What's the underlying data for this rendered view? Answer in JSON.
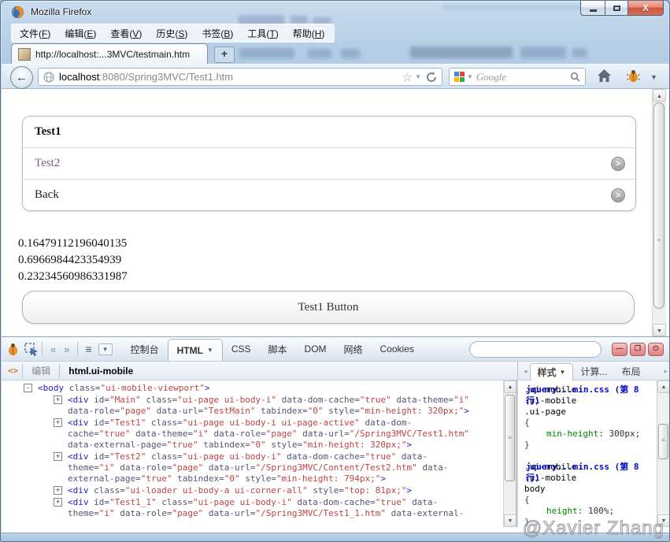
{
  "window": {
    "title": "Mozilla Firefox"
  },
  "titlebar": {
    "buttons": [
      "minimize",
      "maximize",
      "close"
    ],
    "close_glyph": "X"
  },
  "menu": {
    "items": [
      {
        "pre": "文件(",
        "key": "F",
        "post": ")"
      },
      {
        "pre": "编辑(",
        "key": "E",
        "post": ")"
      },
      {
        "pre": "查看(",
        "key": "V",
        "post": ")"
      },
      {
        "pre": "历史(",
        "key": "S",
        "post": ")"
      },
      {
        "pre": "书签(",
        "key": "B",
        "post": ")"
      },
      {
        "pre": "工具(",
        "key": "T",
        "post": ")"
      },
      {
        "pre": "帮助(",
        "key": "H",
        "post": ")"
      }
    ]
  },
  "tabbar": {
    "tab_title": "http://localhost:...3MVC/testmain.htm",
    "new_tab_label": "+"
  },
  "navbar": {
    "back_glyph": "←",
    "url_host": "localhost",
    "url_path": ":8080/Spring3MVC/Test1.htm",
    "star_glyph": "☆",
    "search_placeholder": "Google"
  },
  "page": {
    "list_items": [
      {
        "label": "Test1",
        "style": "header",
        "chevron": false
      },
      {
        "label": "Test2",
        "style": "visited",
        "chevron": true
      },
      {
        "label": "Back",
        "style": "normal",
        "chevron": true
      }
    ],
    "chevron_glyph": ">",
    "random_numbers": [
      "0.16479112196040135",
      "0.6966984423354939",
      "0.23234560986331987"
    ],
    "button_label": "Test1 Button"
  },
  "firebug": {
    "tabs": [
      {
        "label": "控制台",
        "active": false,
        "caret": false
      },
      {
        "label": "HTML",
        "active": true,
        "caret": true
      },
      {
        "label": "CSS",
        "active": false,
        "caret": false
      },
      {
        "label": "脚本",
        "active": false,
        "caret": false
      },
      {
        "label": "DOM",
        "active": false,
        "caret": false
      },
      {
        "label": "网络",
        "active": false,
        "caret": false
      },
      {
        "label": "Cookies",
        "active": false,
        "caret": false
      }
    ],
    "edit_label": "编辑",
    "breadcrumb": "html.ui-mobile",
    "style_tabs": [
      {
        "label": "样式",
        "active": true,
        "caret": true
      },
      {
        "label": "计算...",
        "active": false,
        "caret": false
      },
      {
        "label": "布局",
        "active": false,
        "caret": false
      }
    ],
    "tree": [
      {
        "exp": "-",
        "indent": 0,
        "parts": [
          [
            "tag",
            "<body"
          ],
          [
            "attr",
            " class="
          ],
          [
            "val",
            "\"ui-mobile-viewport\""
          ],
          [
            "tag",
            ">"
          ]
        ]
      },
      {
        "exp": "+",
        "indent": 1,
        "parts": [
          [
            "tag",
            "<div"
          ],
          [
            "attr",
            " id="
          ],
          [
            "val",
            "\"Main\""
          ],
          [
            "attr",
            " class="
          ],
          [
            "val",
            "\"ui-page ui-body-i\""
          ],
          [
            "attr",
            " data-dom-cache="
          ],
          [
            "val",
            "\"true\""
          ],
          [
            "attr",
            " data-theme="
          ],
          [
            "val",
            "\"i\""
          ],
          [
            "attr",
            " data-role="
          ],
          [
            "val",
            "\"page\""
          ],
          [
            "attr",
            " data-url="
          ],
          [
            "val",
            "\"TestMain\""
          ],
          [
            "attr",
            " tabindex="
          ],
          [
            "val",
            "\"0\""
          ],
          [
            "attr",
            " style="
          ],
          [
            "val",
            "\"min-height: 320px;\""
          ],
          [
            "tag",
            ">"
          ]
        ]
      },
      {
        "exp": "+",
        "indent": 1,
        "parts": [
          [
            "tag",
            "<div"
          ],
          [
            "attr",
            " id="
          ],
          [
            "val",
            "\"Test1\""
          ],
          [
            "attr",
            " class="
          ],
          [
            "val",
            "\"ui-page ui-body-i ui-page-active\""
          ],
          [
            "attr",
            " data-dom-cache="
          ],
          [
            "val",
            "\"true\""
          ],
          [
            "attr",
            " data-theme="
          ],
          [
            "val",
            "\"i\""
          ],
          [
            "attr",
            " data-role="
          ],
          [
            "val",
            "\"page\""
          ],
          [
            "attr",
            " data-url="
          ],
          [
            "val",
            "\"/Spring3MVC/Test1.htm\""
          ],
          [
            "attr",
            " data-external-page="
          ],
          [
            "val",
            "\"true\""
          ],
          [
            "attr",
            " tabindex="
          ],
          [
            "val",
            "\"0\""
          ],
          [
            "attr",
            " style="
          ],
          [
            "val",
            "\"min-height: 320px;\""
          ],
          [
            "tag",
            ">"
          ]
        ]
      },
      {
        "exp": "+",
        "indent": 1,
        "parts": [
          [
            "tag",
            "<div"
          ],
          [
            "attr",
            " id="
          ],
          [
            "val",
            "\"Test2\""
          ],
          [
            "attr",
            " class="
          ],
          [
            "val",
            "\"ui-page ui-body-i\""
          ],
          [
            "attr",
            " data-dom-cache="
          ],
          [
            "val",
            "\"true\""
          ],
          [
            "attr",
            " data-theme="
          ],
          [
            "val",
            "\"i\""
          ],
          [
            "attr",
            " data-role="
          ],
          [
            "val",
            "\"page\""
          ],
          [
            "attr",
            " data-url="
          ],
          [
            "val",
            "\"/Spring3MVC/Content/Test2.htm\""
          ],
          [
            "attr",
            " data-external-page="
          ],
          [
            "val",
            "\"true\""
          ],
          [
            "attr",
            " tabindex="
          ],
          [
            "val",
            "\"0\""
          ],
          [
            "attr",
            " style="
          ],
          [
            "val",
            "\"min-height: 794px;\""
          ],
          [
            "tag",
            ">"
          ]
        ]
      },
      {
        "exp": "+",
        "indent": 1,
        "parts": [
          [
            "tag",
            "<div"
          ],
          [
            "attr",
            " class="
          ],
          [
            "val",
            "\"ui-loader ui-body-a ui-corner-all\""
          ],
          [
            "attr",
            " style="
          ],
          [
            "val",
            "\"top: 81px;\""
          ],
          [
            "tag",
            ">"
          ]
        ]
      },
      {
        "exp": "+",
        "indent": 1,
        "parts": [
          [
            "tag",
            "<div"
          ],
          [
            "attr",
            " id="
          ],
          [
            "val",
            "\"Test1_1\""
          ],
          [
            "attr",
            " class="
          ],
          [
            "val",
            "\"ui-page ui-body-i\""
          ],
          [
            "attr",
            " data-dom-cache="
          ],
          [
            "val",
            "\"true\""
          ],
          [
            "attr",
            " data-theme="
          ],
          [
            "val",
            "\"i\""
          ],
          [
            "attr",
            " data-role="
          ],
          [
            "val",
            "\"page\""
          ],
          [
            "attr",
            " data-url="
          ],
          [
            "val",
            "\"/Spring3MVC/Test1_1.htm\""
          ],
          [
            "attr",
            " data-external-"
          ]
        ]
      }
    ],
    "css_rules": [
      {
        "file": "jquery...min.css (第 8 行)",
        "selectors": [
          ".ui-mobile",
          ".ui-mobile",
          ".ui-page"
        ],
        "props": [
          {
            "name": "min-height",
            "value": "300px;"
          }
        ]
      },
      {
        "file": "jquery...min.css (第 8 行)",
        "selectors": [
          ".ui-mobile",
          ".ui-mobile",
          "body"
        ],
        "props": [
          {
            "name": "height",
            "value": "100%;"
          }
        ]
      }
    ]
  },
  "watermark": "@Xavier Zhang"
}
